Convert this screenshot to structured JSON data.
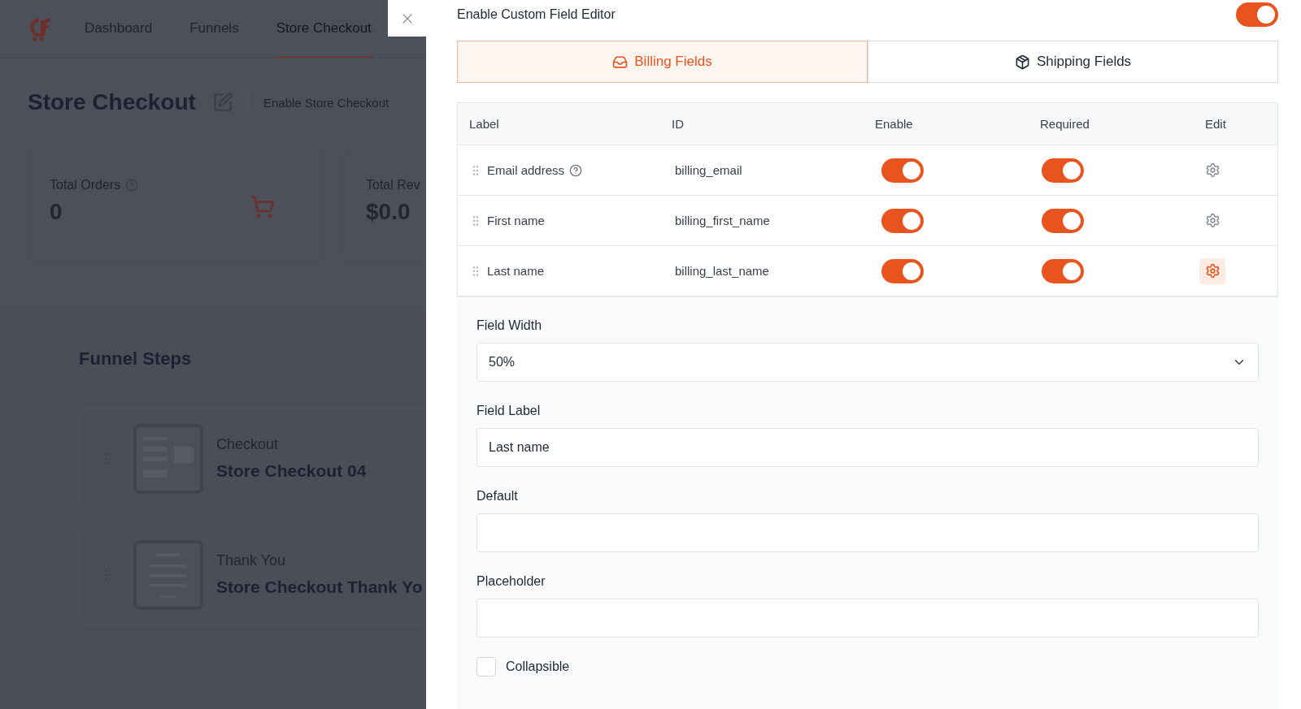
{
  "background": {
    "nav": [
      {
        "label": "Dashboard",
        "selected": false
      },
      {
        "label": "Funnels",
        "selected": false
      },
      {
        "label": "Store Checkout",
        "selected": true
      }
    ],
    "page_title": "Store Checkout",
    "enable_label": "Enable Store Checkout",
    "stats": [
      {
        "label": "Total Orders",
        "value": "0",
        "kind": "orders"
      },
      {
        "label": "Total Rev",
        "value": "$0.0",
        "kind": "revenue"
      }
    ],
    "funnel_steps": {
      "title": "Funnel Steps",
      "steps": [
        {
          "type": "Checkout",
          "name": "Store Checkout 04"
        },
        {
          "type": "Thank You",
          "name": "Store Checkout Thank Yo"
        }
      ]
    }
  },
  "drawer": {
    "editor_toggle": {
      "label": "Enable Custom Field Editor",
      "on": true
    },
    "tabs": [
      {
        "label": "Billing Fields",
        "selected": true,
        "kind": "billing"
      },
      {
        "label": "Shipping Fields",
        "selected": false,
        "kind": "shipping"
      }
    ],
    "table": {
      "columns": [
        "Label",
        "ID",
        "Enable",
        "Required",
        "Edit"
      ],
      "rows": [
        {
          "label": "Email address",
          "help": true,
          "id": "billing_email",
          "enable": true,
          "required": true,
          "editing": false
        },
        {
          "label": "First name",
          "help": false,
          "id": "billing_first_name",
          "enable": true,
          "required": true,
          "editing": false
        },
        {
          "label": "Last name",
          "help": false,
          "id": "billing_last_name",
          "enable": true,
          "required": true,
          "editing": true
        }
      ]
    },
    "edit_form": {
      "fields": [
        {
          "kind": "select",
          "label": "Field Width",
          "value": "50%"
        },
        {
          "kind": "text",
          "label": "Field Label",
          "value": "Last name"
        },
        {
          "kind": "text",
          "label": "Default"
        },
        {
          "kind": "text",
          "label": "Placeholder"
        }
      ],
      "collapsible": {
        "label": "Collapsible",
        "checked": false
      }
    }
  }
}
